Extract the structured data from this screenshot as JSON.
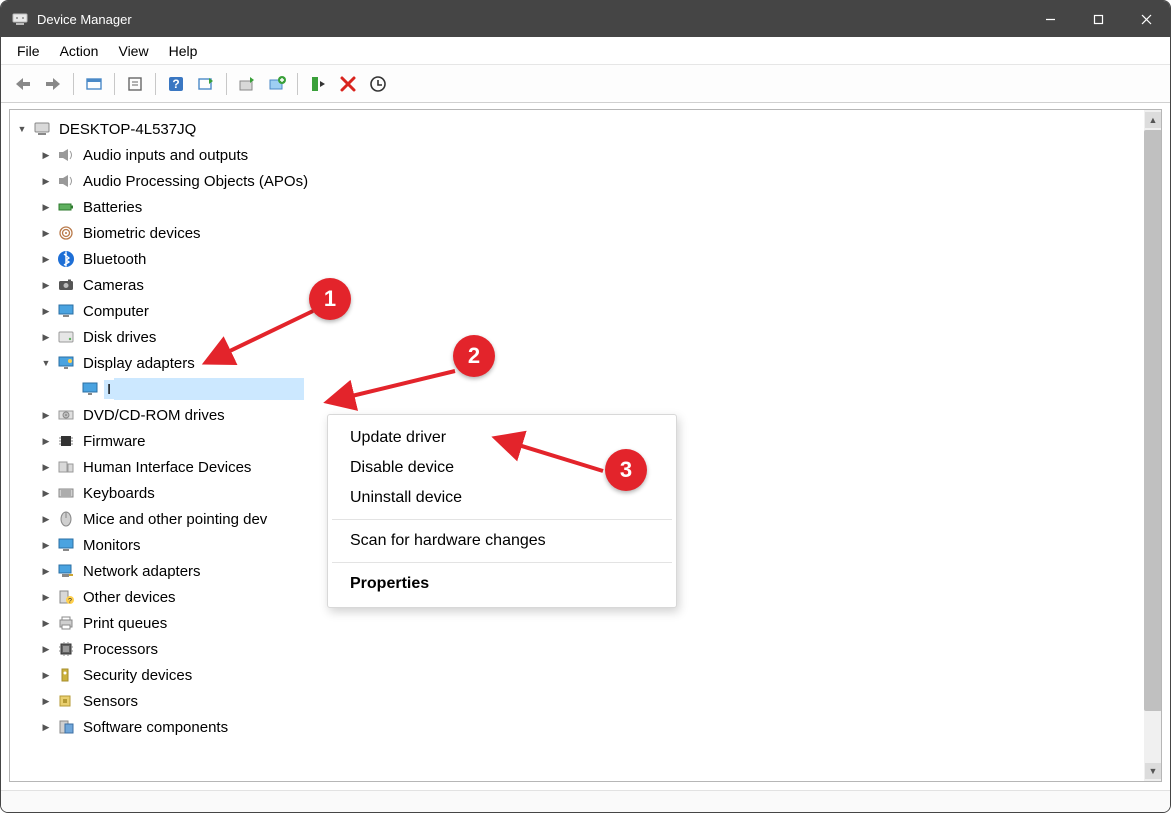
{
  "window": {
    "title": "Device Manager"
  },
  "menubar": [
    "File",
    "Action",
    "View",
    "Help"
  ],
  "toolbar_icons": [
    "back-icon",
    "forward-icon",
    "show-hidden-icon",
    "properties-icon",
    "help-icon",
    "scan-icon",
    "update-driver-icon",
    "add-legacy-icon",
    "enable-icon",
    "disable-icon",
    "uninstall-icon",
    "action-icon"
  ],
  "root": {
    "name": "DESKTOP-4L537JQ"
  },
  "categories": [
    {
      "label": "Audio inputs and outputs",
      "icon": "speaker",
      "expander": "▶"
    },
    {
      "label": "Audio Processing Objects (APOs)",
      "icon": "speaker",
      "expander": "▶"
    },
    {
      "label": "Batteries",
      "icon": "battery",
      "expander": "▶"
    },
    {
      "label": "Biometric devices",
      "icon": "fingerprint",
      "expander": "▶"
    },
    {
      "label": "Bluetooth",
      "icon": "bluetooth",
      "expander": "▶"
    },
    {
      "label": "Cameras",
      "icon": "camera",
      "expander": "▶"
    },
    {
      "label": "Computer",
      "icon": "monitor",
      "expander": "▶"
    },
    {
      "label": "Disk drives",
      "icon": "disk",
      "expander": "▶"
    },
    {
      "label": "Display adapters",
      "icon": "display",
      "expander": "▼",
      "expanded": true
    },
    {
      "label": "DVD/CD-ROM drives",
      "icon": "cdrom",
      "expander": "▶"
    },
    {
      "label": "Firmware",
      "icon": "chip",
      "expander": "▶"
    },
    {
      "label": "Human Interface Devices",
      "icon": "hid",
      "expander": "▶"
    },
    {
      "label": "Keyboards",
      "icon": "keyboard",
      "expander": "▶"
    },
    {
      "label": "Mice and other pointing dev",
      "icon": "mouse",
      "expander": "▶"
    },
    {
      "label": "Monitors",
      "icon": "monitor",
      "expander": "▶"
    },
    {
      "label": "Network adapters",
      "icon": "network",
      "expander": "▶"
    },
    {
      "label": "Other devices",
      "icon": "other",
      "expander": "▶"
    },
    {
      "label": "Print queues",
      "icon": "printer",
      "expander": "▶"
    },
    {
      "label": "Processors",
      "icon": "cpu",
      "expander": "▶"
    },
    {
      "label": "Security devices",
      "icon": "security",
      "expander": "▶"
    },
    {
      "label": "Sensors",
      "icon": "sensor",
      "expander": "▶"
    },
    {
      "label": "Software components",
      "icon": "software",
      "expander": "▶"
    }
  ],
  "selected_device": {
    "label": "I"
  },
  "context_menu": {
    "items": [
      "Update driver",
      "Disable device",
      "Uninstall device"
    ],
    "items2": [
      "Scan for hardware changes"
    ],
    "properties": "Properties"
  },
  "annotations": {
    "1": "1",
    "2": "2",
    "3": "3"
  }
}
